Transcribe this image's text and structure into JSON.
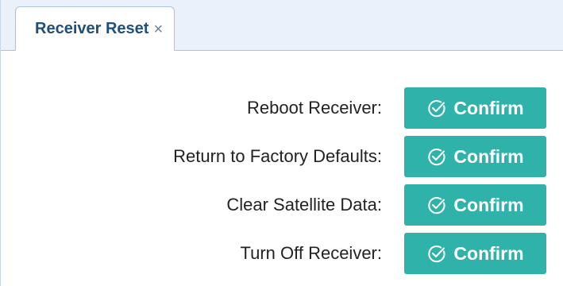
{
  "tab": {
    "title": "Receiver Reset",
    "close_glyph": "×"
  },
  "rows": [
    {
      "label": "Reboot Receiver:",
      "button_label": "Confirm",
      "button_icon": "check-circle-icon"
    },
    {
      "label": "Return to Factory Defaults:",
      "button_label": "Confirm",
      "button_icon": "check-circle-icon"
    },
    {
      "label": "Clear Satellite Data:",
      "button_label": "Confirm",
      "button_icon": "check-circle-icon"
    },
    {
      "label": "Turn Off Receiver:",
      "button_label": "Confirm",
      "button_icon": "check-circle-icon"
    }
  ],
  "colors": {
    "button": "#2fb2aa",
    "tab_title": "#1f4f7a",
    "tabbar_bg": "#eaf1fa"
  }
}
